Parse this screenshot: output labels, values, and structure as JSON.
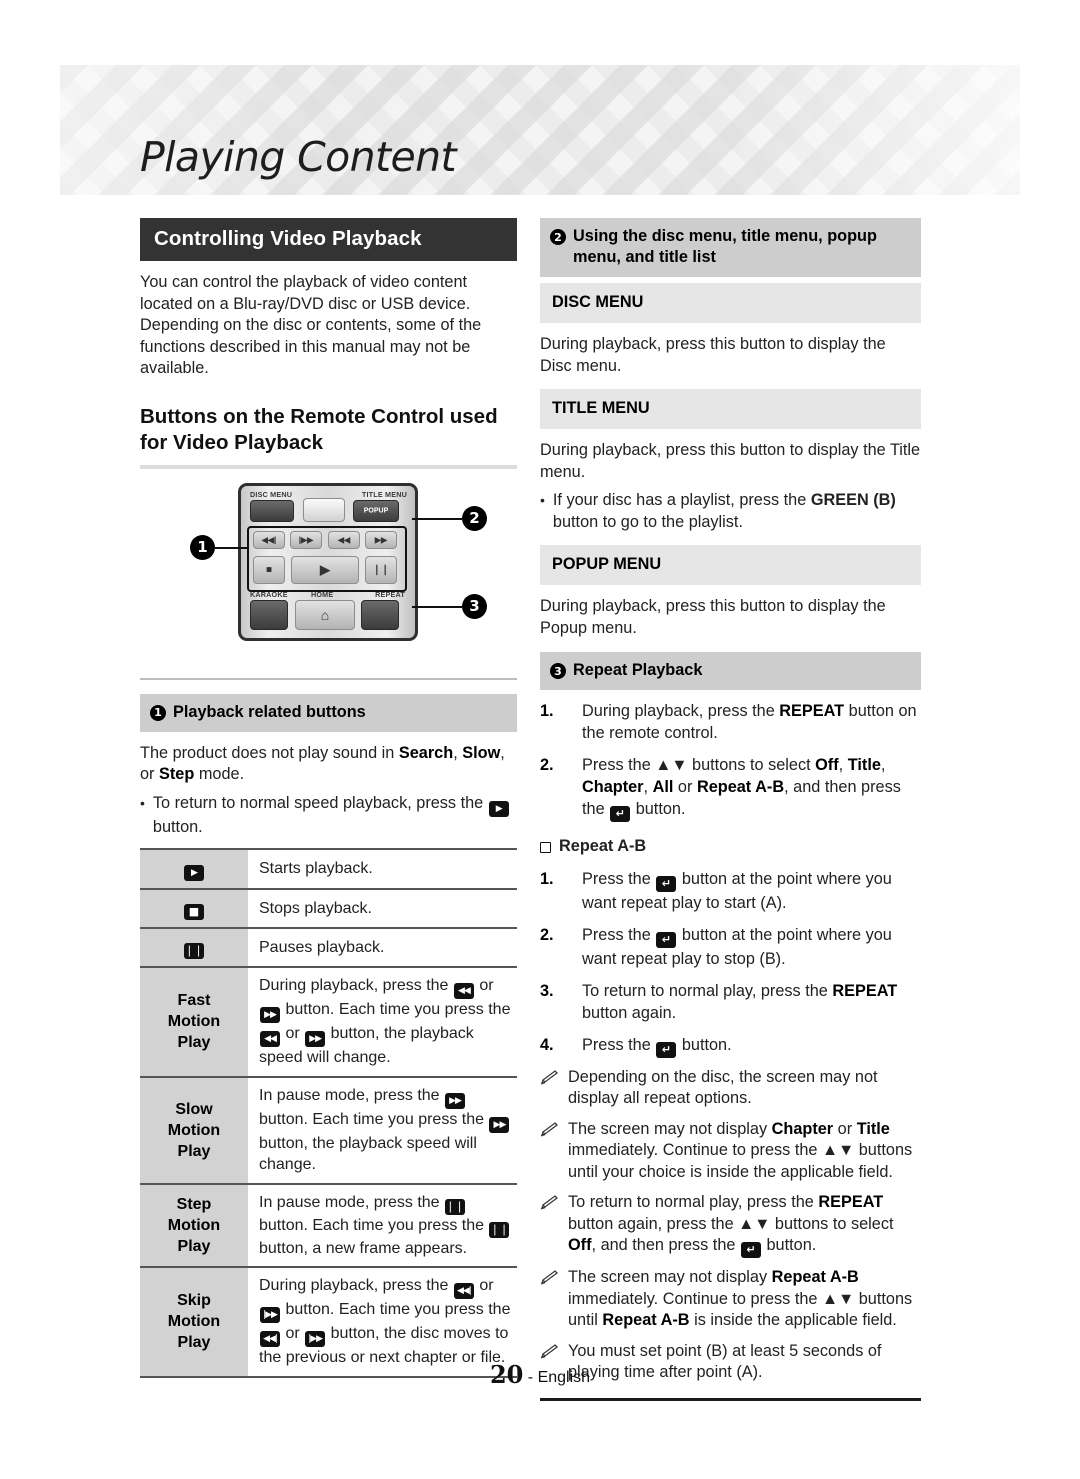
{
  "page": {
    "title": "Playing Content",
    "footer_number": "20",
    "footer_sep": "- ",
    "footer_lang": "English"
  },
  "left": {
    "section_bar": "Controlling Video Playback",
    "intro": "You can control the playback of video content located on a Blu-ray/DVD disc or USB device. Depending on the disc or contents, some of the functions described in this manual may not be available.",
    "h2": "Buttons on the Remote Control used for Video Playback",
    "remote": {
      "label_disc_menu": "DISC MENU",
      "label_title_menu": "TITLE MENU",
      "label_popup": "POPUP",
      "label_karaoke": "KARAOKE",
      "label_home": "HOME",
      "label_repeat": "REPEAT",
      "key_prev": "◀◀|",
      "key_next": "|▶▶",
      "key_rew": "◀◀",
      "key_ff": "▶▶",
      "key_stop": "■",
      "key_play": "▶",
      "key_pause": "❘❘",
      "key_home_icon": "⌂",
      "callout_1": "1",
      "callout_2": "2",
      "callout_3": "3"
    },
    "section1": {
      "num": "1",
      "heading": "Playback related buttons",
      "para_a": "The product does not play sound in ",
      "para_b1": "Search",
      "para_sep1": ", ",
      "para_b2": "Slow",
      "para_c": ", or ",
      "para_b3": "Step",
      "para_d": " mode.",
      "bullet_a": "To return to normal speed playback, press the ",
      "bullet_b": " button."
    },
    "table": [
      {
        "key_type": "glyph",
        "key": "▶",
        "desc": "Starts playback."
      },
      {
        "key_type": "glyph",
        "key": "■",
        "desc": "Stops playback."
      },
      {
        "key_type": "glyph",
        "key": "❘❘",
        "desc": "Pauses playback."
      },
      {
        "key_type": "text",
        "key": "Fast Motion Play",
        "desc": "During playback, press the [REW] or [FF] button. Each time you press the [REW] or [FF] button, the playback speed will change."
      },
      {
        "key_type": "text",
        "key": "Slow Motion Play",
        "desc": "In pause mode, press the [FF] button. Each time you press the [FF] button, the playback speed will change."
      },
      {
        "key_type": "text",
        "key": "Step Motion Play",
        "desc": "In pause mode, press the [PAUSE] button. Each time you press the [PAUSE] button, a new frame appears."
      },
      {
        "key_type": "text",
        "key": "Skip Motion Play",
        "desc": "During playback, press the [PREV] or [NEXT] button. Each time you press the [PREV] or [NEXT] button, the disc moves to the previous or next chapter or file."
      }
    ]
  },
  "right": {
    "section2": {
      "num": "2",
      "heading": "Using the disc menu, title menu, popup menu, and title list"
    },
    "disc_menu": {
      "heading": "DISC MENU",
      "body": "During playback, press this button to display the Disc menu."
    },
    "title_menu": {
      "heading": "TITLE MENU",
      "body": "During playback, press this button to display the Title menu.",
      "bullet_a": "If your disc has a playlist, press the ",
      "bullet_b": "GREEN (B)",
      "bullet_c": " button to go to the playlist."
    },
    "popup_menu": {
      "heading": "POPUP MENU",
      "body": "During playback, press this button to display the Popup menu."
    },
    "section3": {
      "num": "3",
      "heading": "Repeat Playback"
    },
    "repeat_steps": [
      {
        "n": "1.",
        "a": "During playback, press the ",
        "b": "REPEAT",
        "c": " button on the remote control."
      },
      {
        "n": "2.",
        "a": "Press the ▲▼ buttons to select ",
        "b": "Off",
        "c": ", ",
        "d": "Title",
        "e": ", ",
        "f": "Chapter",
        "g": ", ",
        "h": "All",
        "i": " or ",
        "j": "Repeat A-B",
        "k": ", and then press the ",
        "l": " button."
      }
    ],
    "repeat_ab": {
      "heading": "Repeat A-B",
      "steps": [
        {
          "n": "1.",
          "a": "Press the ",
          "b": " button at the point where you want repeat play to start (A)."
        },
        {
          "n": "2.",
          "a": "Press the ",
          "b": " button at the point where you want repeat play to stop (B)."
        },
        {
          "n": "3.",
          "a": "To return to normal play, press the ",
          "bold": "REPEAT",
          "b": " button again."
        },
        {
          "n": "4.",
          "a": "Press the ",
          "b": " button."
        }
      ]
    },
    "notes": [
      {
        "a": "Depending on the disc, the screen may not display all repeat options."
      },
      {
        "a": "The screen may not display ",
        "b1": "Chapter",
        "m1": " or ",
        "b2": "Title",
        "m2": " immediately. Continue to press the ▲▼ buttons until your choice is inside the applicable field."
      },
      {
        "a": "To return to normal play, press the ",
        "b1": "REPEAT",
        "m1": " button again, press the ▲▼ buttons to select ",
        "b2": "Off",
        "m2": ", and then press the ",
        "m3": " button."
      },
      {
        "a": "The screen may not display ",
        "b1": "Repeat A-B",
        "m1": " immediately. Continue to press the ▲▼ buttons until ",
        "b2": "Repeat A-B",
        "m2": " is inside the applicable field."
      },
      {
        "a": "You must set point (B) at least 5 seconds of playing time after point (A)."
      }
    ]
  },
  "glyphs": {
    "play": "▶",
    "stop": "■",
    "pause": "❘❘",
    "rew": "◀◀",
    "ff": "▶▶",
    "prev": "◀◀|",
    "next": "|▶▶",
    "enter": "↵"
  }
}
